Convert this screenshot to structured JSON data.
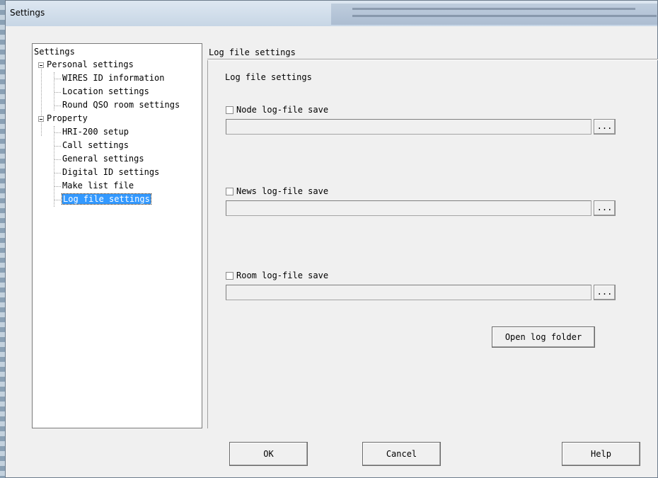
{
  "window": {
    "title": "Settings"
  },
  "tree": {
    "root": "Settings",
    "groups": [
      {
        "label": "Personal settings",
        "items": [
          "WIRES ID information",
          "Location settings",
          "Round QSO room settings"
        ]
      },
      {
        "label": "Property",
        "items": [
          "HRI-200 setup",
          "Call settings",
          "General settings",
          "Digital ID settings",
          "Make list file",
          "Log file settings"
        ]
      }
    ],
    "selected": "Log file settings"
  },
  "panel": {
    "title": "Log file settings",
    "group_title": "Log file settings",
    "node": {
      "label": "Node log-file save",
      "checked": false,
      "path": "",
      "browse": "..."
    },
    "news": {
      "label": "News log-file save",
      "checked": false,
      "path": "",
      "browse": "..."
    },
    "room": {
      "label": "Room log-file save",
      "checked": false,
      "path": "",
      "browse": "..."
    },
    "open_folder": "Open log folder"
  },
  "buttons": {
    "ok": "OK",
    "cancel": "Cancel",
    "help": "Help"
  }
}
